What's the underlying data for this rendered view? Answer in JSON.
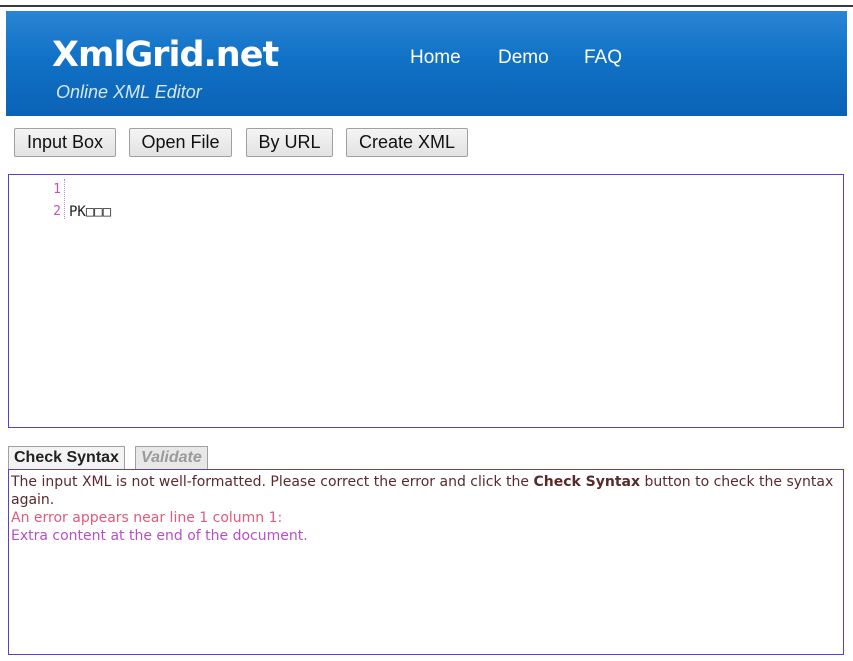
{
  "header": {
    "logo_text": "XmlGrid.net",
    "tagline": "Online XML Editor",
    "nav": [
      {
        "label": "Home"
      },
      {
        "label": "Demo"
      },
      {
        "label": "FAQ"
      }
    ],
    "colors": {
      "header_bg": "#1072c6",
      "nav_text": "#ffffff"
    }
  },
  "toolbar": {
    "buttons": [
      {
        "label": "Input Box"
      },
      {
        "label": "Open File"
      },
      {
        "label": "By URL"
      },
      {
        "label": "Create XML"
      }
    ]
  },
  "editor": {
    "line_numbers": [
      "1",
      "2"
    ],
    "lines": [
      "",
      "PK□□□"
    ],
    "colors": {
      "border": "#5a3fcf",
      "line_number": "#c64ec6"
    }
  },
  "tabs": [
    {
      "label": "Check Syntax",
      "active": true
    },
    {
      "label": "Validate",
      "active": false
    }
  ],
  "output": {
    "message_prefix": "The input XML is not well-formatted. Please correct the error and click the ",
    "message_bold": "Check Syntax",
    "message_suffix": " button to check the syntax again.",
    "error_location": "An error appears near line 1 column 1:",
    "error_detail": "Extra content at the end of the document.",
    "colors": {
      "error_location": "#e05a7a",
      "error_detail": "#b84ec8"
    }
  }
}
